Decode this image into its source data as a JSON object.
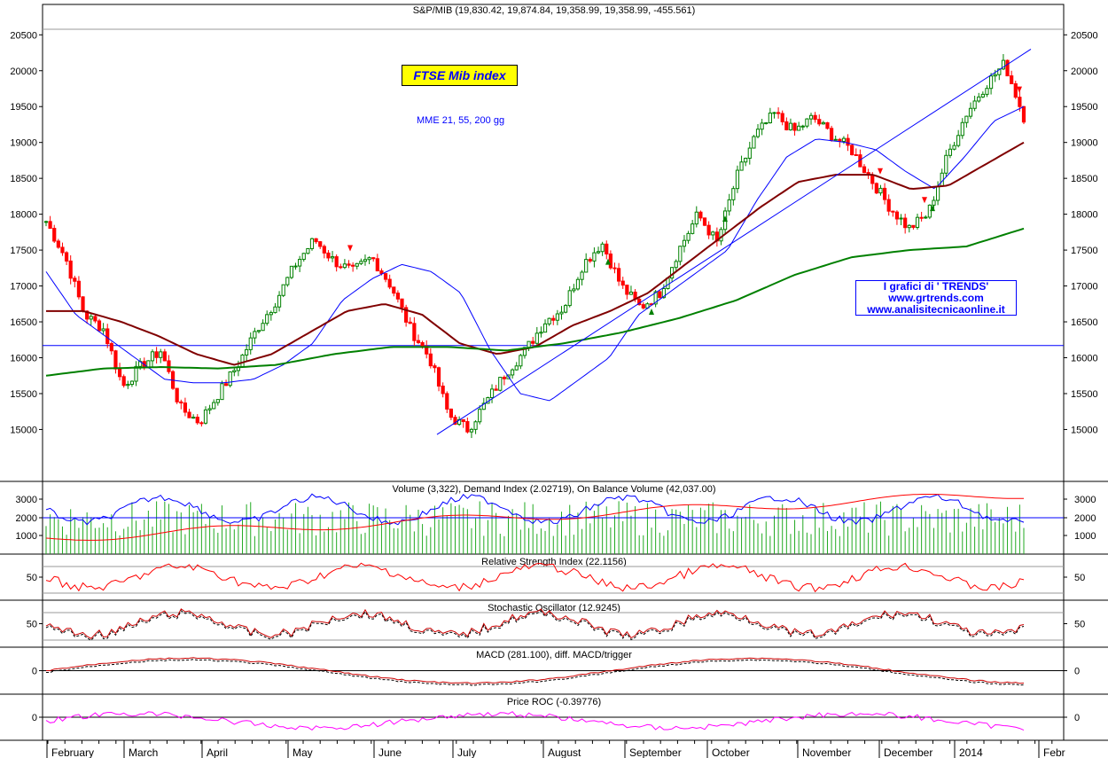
{
  "chart_data": {
    "type": "candlestick",
    "instrument_header": "S&P/MIB (19,830.42, 19,874.84, 19,358.99, 19,358.99, -455.561)",
    "logo_label": "FTSE Mib  index",
    "ma_note": "MME 21, 55, 200 gg",
    "credits": [
      "I grafici di ' TRENDS'",
      "www.grtrends.com",
      "www.analisitecnicaonline.it"
    ],
    "months": [
      "February",
      "March",
      "April",
      "May",
      "June",
      "July",
      "August",
      "September",
      "October",
      "November",
      "December",
      "2014",
      "Febr"
    ],
    "price_axis": {
      "ticks": [
        15000,
        15500,
        16000,
        16500,
        17000,
        17500,
        18000,
        18500,
        19000,
        19500,
        20000,
        20500
      ],
      "ylim": [
        14400,
        20800
      ]
    },
    "horizontal_level": 16170,
    "trendline": {
      "from": 14930,
      "to": 20300
    },
    "price_anchors": [
      17900,
      17400,
      16600,
      16400,
      15600,
      15900,
      16100,
      15300,
      15100,
      15500,
      15900,
      16400,
      16800,
      17300,
      17650,
      17350,
      17200,
      17400,
      17000,
      16400,
      16000,
      15200,
      15000,
      15400,
      15800,
      16100,
      16500,
      16700,
      17300,
      17600,
      17000,
      16700,
      16900,
      17500,
      18000,
      17600,
      18500,
      19100,
      19400,
      19150,
      19350,
      19100,
      18900,
      18500,
      18100,
      17800,
      18000,
      18800,
      19400,
      19800,
      20100,
      19359
    ],
    "moving_averages": [
      {
        "name": "21",
        "color": "#0000ff",
        "values": [
          17200,
          16600,
          16300,
          16000,
          15700,
          15650,
          15650,
          15700,
          15900,
          16200,
          16800,
          17100,
          17300,
          17200,
          16900,
          16100,
          15500,
          15400,
          15700,
          16000,
          16600,
          16900,
          17200,
          17500,
          18200,
          18800,
          19050,
          19000,
          18900,
          18600,
          18350,
          18800,
          19300,
          19500
        ]
      },
      {
        "name": "55",
        "color": "#800000",
        "values": [
          16650,
          16650,
          16500,
          16300,
          16050,
          15900,
          16050,
          16350,
          16650,
          16750,
          16600,
          16200,
          16050,
          16150,
          16450,
          16650,
          16900,
          17300,
          17700,
          18100,
          18450,
          18550,
          18550,
          18350,
          18400,
          18700,
          19000
        ]
      },
      {
        "name": "200",
        "color": "#008000",
        "values": [
          15750,
          15850,
          15870,
          15850,
          15900,
          16050,
          16150,
          16150,
          16100,
          16200,
          16350,
          16550,
          16800,
          17150,
          17400,
          17500,
          17550,
          17800
        ]
      }
    ],
    "panels": [
      {
        "title": "Volume (3,322), Demand Index (2.02719), On Balance Volume (42,037.00)",
        "ticks": [
          1000,
          2000,
          3000
        ]
      },
      {
        "title": "Relative Strength Index (22.1156)",
        "ticks": [
          50
        ]
      },
      {
        "title": "Stochastic Oscillator (12.9245)",
        "ticks": [
          50
        ]
      },
      {
        "title": "MACD (281.100), diff. MACD/trigger",
        "ticks": [
          0
        ]
      },
      {
        "title": "Price ROC (-0.39776)",
        "ticks": [
          0
        ]
      }
    ]
  }
}
